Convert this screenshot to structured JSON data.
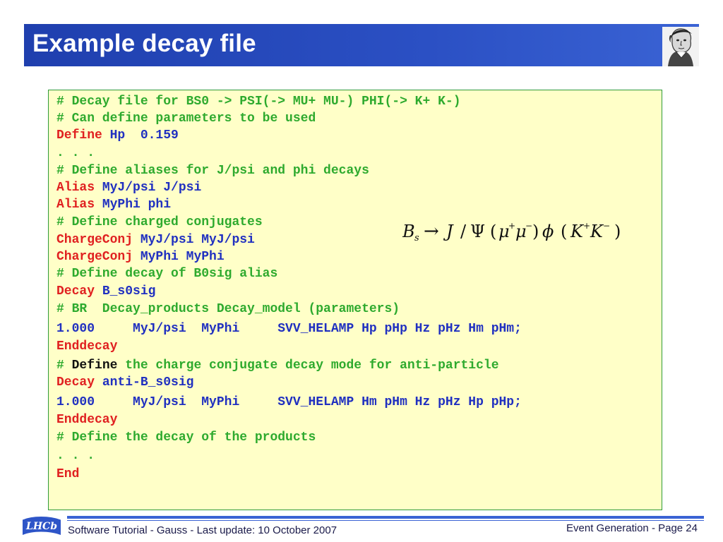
{
  "slide": {
    "title": "Example decay file"
  },
  "code_lines": [
    [
      {
        "t": "# Decay file for BS0 -> PSI(-> MU+ MU-) PHI(-> K+ K-)",
        "c": "g"
      }
    ],
    [
      {
        "t": "# Can define parameters to be used",
        "c": "g"
      }
    ],
    [
      {
        "t": "Define",
        "c": "r"
      },
      {
        "t": " Hp  0.159",
        "c": "b"
      }
    ],
    [
      {
        "t": ". . .",
        "c": "g"
      }
    ],
    [
      {
        "t": "# Define aliases for J/psi and phi decays",
        "c": "g"
      }
    ],
    [
      {
        "t": "Alias",
        "c": "r"
      },
      {
        "t": " MyJ/psi J/psi",
        "c": "b"
      }
    ],
    [
      {
        "t": "Alias",
        "c": "r"
      },
      {
        "t": " MyPhi phi",
        "c": "b"
      }
    ],
    [
      {
        "t": "# Define charged conjugates",
        "c": "g"
      }
    ],
    [
      {
        "t": "ChargeConj",
        "c": "r"
      },
      {
        "t": " MyJ/psi MyJ/psi",
        "c": "b"
      }
    ],
    [
      {
        "t": "ChargeConj",
        "c": "r"
      },
      {
        "t": " MyPhi MyPhi",
        "c": "b"
      }
    ],
    [
      {
        "t": "# Define decay of B0sig alias",
        "c": "g"
      }
    ],
    [
      {
        "t": "Decay",
        "c": "r"
      },
      {
        "t": " B_s0sig",
        "c": "b"
      }
    ],
    [
      {
        "t": "# BR  Decay_products Decay_model (parameters)",
        "c": "g"
      }
    ],
    [
      {
        "t": "1.000     MyJ/psi  MyPhi     SVV_HELAMP Hp pHp Hz pHz Hm pHm;",
        "c": "b"
      }
    ],
    [
      {
        "t": "Enddecay",
        "c": "r"
      }
    ],
    [
      {
        "t": "# ",
        "c": "g"
      },
      {
        "t": "Define",
        "c": "k"
      },
      {
        "t": " the charge conjugate decay mode for anti-particle",
        "c": "g"
      }
    ],
    [
      {
        "t": "Decay",
        "c": "r"
      },
      {
        "t": " anti-B_s0sig",
        "c": "b"
      }
    ],
    [
      {
        "t": "1.000     MyJ/psi  MyPhi     SVV_HELAMP Hm pHm Hz pHz Hp pHp;",
        "c": "b"
      }
    ],
    [
      {
        "t": "Enddecay",
        "c": "r"
      }
    ],
    [
      {
        "t": "# Define the decay of the products",
        "c": "g"
      }
    ],
    [
      {
        "t": ". . .",
        "c": "g"
      }
    ],
    [
      {
        "t": "End",
        "c": "r"
      }
    ]
  ],
  "formula": {
    "B": "B",
    "s": "s",
    "arrow": "→",
    "J": "J",
    "slash": "/",
    "Psi": "Ψ",
    "lparen1": "(",
    "mu1": "μ",
    "plus1": "+",
    "mu2": "μ",
    "minus1": "−",
    "rparen1": ")",
    "phi": "ϕ",
    "lparen2": "(",
    "K1": "K",
    "plus2": "+",
    "K2": "K",
    "minus2": "−",
    "rparen2": ")"
  },
  "footer": {
    "left": "Software Tutorial - Gauss - Last update: 10 October 2007",
    "right": "Event Generation - Page 24",
    "logo_text": "LHCb"
  },
  "colors": {
    "title_bar": "#2b50c4",
    "code_background": "#ffffc8",
    "comment": "#2eaa2e",
    "keyword": "#e02020",
    "value": "#2030c0"
  },
  "icons": {
    "portrait": "gauss-portrait",
    "logo": "lhcb-logo"
  }
}
